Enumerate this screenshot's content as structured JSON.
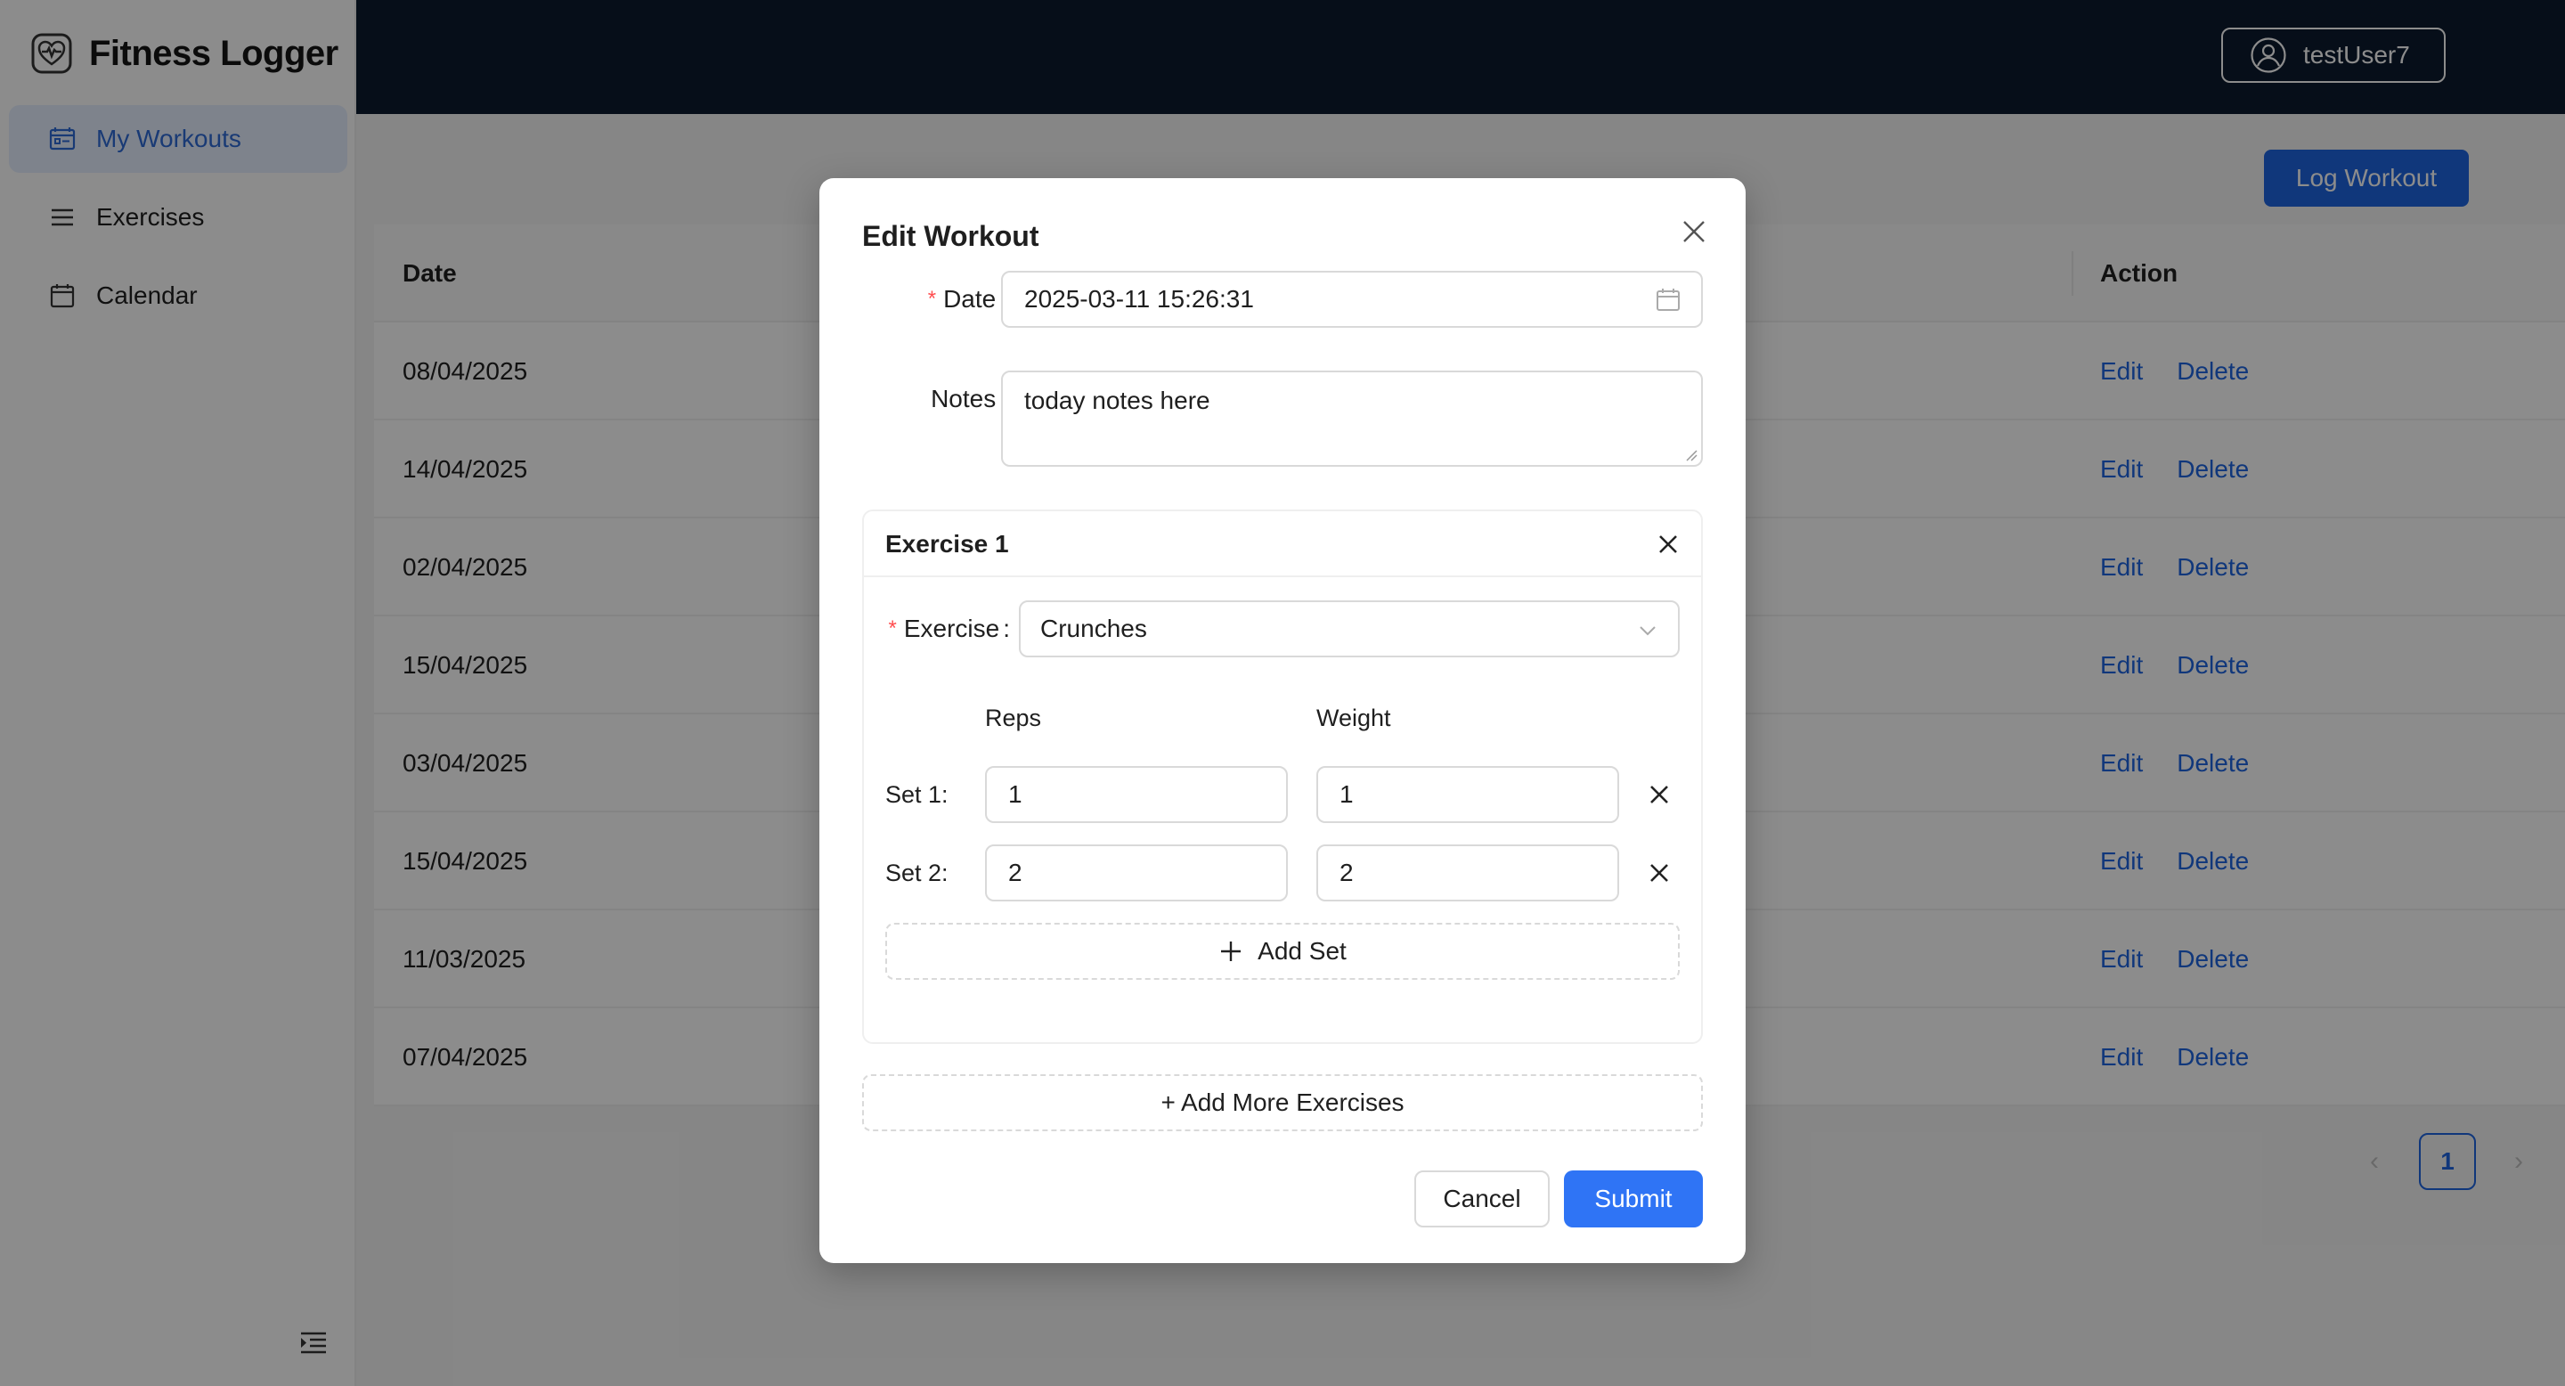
{
  "app": {
    "title": "Fitness Logger",
    "logo_icon": "heart-pulse-icon"
  },
  "sidebar": {
    "items": [
      {
        "label": "My Workouts",
        "icon": "workout-icon",
        "active": true
      },
      {
        "label": "Exercises",
        "icon": "list-icon",
        "active": false
      },
      {
        "label": "Calendar",
        "icon": "calendar-icon",
        "active": false
      }
    ],
    "collapse_icon": "menu-fold-icon"
  },
  "header": {
    "username": "testUser7",
    "user_icon": "user-icon"
  },
  "toolbar": {
    "log_workout_label": "Log Workout"
  },
  "table": {
    "columns": {
      "date": "Date",
      "action": "Action"
    },
    "rows": [
      {
        "date": "08/04/2025"
      },
      {
        "date": "14/04/2025"
      },
      {
        "date": "02/04/2025"
      },
      {
        "date": "15/04/2025"
      },
      {
        "date": "03/04/2025"
      },
      {
        "date": "15/04/2025"
      },
      {
        "date": "11/03/2025"
      },
      {
        "date": "07/04/2025"
      }
    ],
    "edit_label": "Edit",
    "delete_label": "Delete"
  },
  "pagination": {
    "prev": "‹",
    "current": "1",
    "next": "›"
  },
  "modal": {
    "title": "Edit Workout",
    "date_label": "Date",
    "date_value": "2025-03-11 15:26:31",
    "notes_label": "Notes",
    "notes_value": "today notes here",
    "required_mark": "*",
    "colon": ":",
    "exercise_card": {
      "title": "Exercise 1",
      "exercise_label": "Exercise",
      "exercise_value": "Crunches",
      "reps_header": "Reps",
      "weight_header": "Weight",
      "sets": [
        {
          "label": "Set 1:",
          "reps": "1",
          "weight": "1"
        },
        {
          "label": "Set 2:",
          "reps": "2",
          "weight": "2"
        }
      ],
      "add_set_label": "Add Set"
    },
    "add_more_label": "+ Add More Exercises",
    "cancel_label": "Cancel",
    "submit_label": "Submit"
  },
  "colors": {
    "primary": "#1e64e0",
    "submit": "#2f74f5",
    "header_bg": "#0b1a2e",
    "required": "#ff4d4f",
    "active_nav_bg": "#e6efff"
  }
}
